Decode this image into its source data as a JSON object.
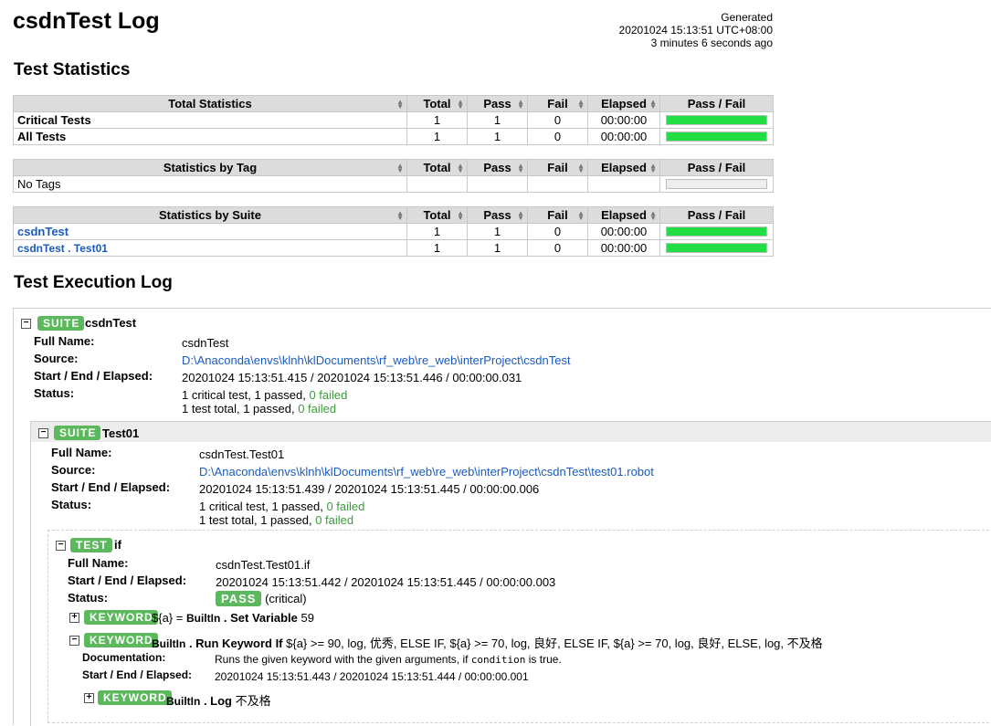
{
  "title": "csdnTest Log",
  "generated": {
    "label": "Generated",
    "timestamp": "20201024 15:13:51 UTC+08:00",
    "ago": "3 minutes 6 seconds ago"
  },
  "sections": {
    "statistics": "Test Statistics",
    "execution": "Test Execution Log"
  },
  "columns": [
    "Total",
    "Pass",
    "Fail",
    "Elapsed",
    "Pass / Fail"
  ],
  "total_stats": {
    "heading": "Total Statistics",
    "rows": [
      {
        "name": "Critical Tests",
        "total": "1",
        "pass": "1",
        "fail": "0",
        "elapsed": "00:00:00",
        "pass_ratio": 1.0
      },
      {
        "name": "All Tests",
        "total": "1",
        "pass": "1",
        "fail": "0",
        "elapsed": "00:00:00",
        "pass_ratio": 1.0
      }
    ]
  },
  "tag_stats": {
    "heading": "Statistics by Tag",
    "rows": [
      {
        "name": "No Tags"
      }
    ]
  },
  "suite_stats": {
    "heading": "Statistics by Suite",
    "rows": [
      {
        "name": "csdnTest",
        "total": "1",
        "pass": "1",
        "fail": "0",
        "elapsed": "00:00:00",
        "pass_ratio": 1.0
      },
      {
        "name": "csdnTest . Test01",
        "total": "1",
        "pass": "1",
        "fail": "0",
        "elapsed": "00:00:00",
        "pass_ratio": 1.0
      }
    ]
  },
  "labels": {
    "full_name": "Full Name:",
    "source": "Source:",
    "times": "Start / End / Elapsed:",
    "status": "Status:",
    "documentation": "Documentation:"
  },
  "suite1": {
    "badge": "SUITE",
    "name": "csdnTest",
    "full_name": "csdnTest",
    "source": "D:\\Anaconda\\envs\\klnh\\klDocuments\\rf_web\\re_web\\interProject\\csdnTest",
    "times": "20201024 15:13:51.415 / 20201024 15:13:51.446 / 00:00:00.031",
    "status1_a": "1 critical test, 1 passed, ",
    "status1_b": "0 failed",
    "status2_a": "1 test total, 1 passed, ",
    "status2_b": "0 failed"
  },
  "suite2": {
    "badge": "SUITE",
    "name": "Test01",
    "full_name": "csdnTest.Test01",
    "source": "D:\\Anaconda\\envs\\klnh\\klDocuments\\rf_web\\re_web\\interProject\\csdnTest\\test01.robot",
    "times": "20201024 15:13:51.439 / 20201024 15:13:51.445 / 00:00:00.006",
    "status1_a": "1 critical test, 1 passed, ",
    "status1_b": "0 failed",
    "status2_a": "1 test total, 1 passed, ",
    "status2_b": "0 failed"
  },
  "test": {
    "badge": "TEST",
    "name": "if",
    "full_name": "csdnTest.Test01.if",
    "times": "20201024 15:13:51.442 / 20201024 15:13:51.445 / 00:00:00.003",
    "status": "PASS",
    "status_note": "(critical)"
  },
  "keyword1": {
    "badge": "KEYWORD",
    "assign": "${a} = ",
    "lib": "BuiltIn",
    "dot": " . ",
    "kw": "Set Variable",
    "args": " 59"
  },
  "keyword2": {
    "badge": "KEYWORD",
    "lib": "BuiltIn",
    "dot": " . ",
    "kw": "Run Keyword If",
    "args": " ${a} >= 90, log, 优秀, ELSE IF, ${a} >= 70, log, 良好, ELSE IF, ${a} >= 70, log, 良好, ELSE, log, 不及格",
    "doc_a": "Runs the given keyword with the given arguments, if ",
    "doc_code": "condition",
    "doc_b": " is true.",
    "times": "20201024 15:13:51.443 / 20201024 15:13:51.444 / 00:00:00.001"
  },
  "keyword3": {
    "badge": "KEYWORD",
    "lib": "BuiltIn",
    "dot": " . ",
    "kw": "Log",
    "args": " 不及格"
  },
  "icons": {
    "expanded": "−",
    "collapsed": "+",
    "sort": "sort-arrows-icon"
  },
  "colors": {
    "pass_green": "#5cb85c",
    "bar_green": "#22dd44",
    "link_blue": "#1a5bbf"
  }
}
